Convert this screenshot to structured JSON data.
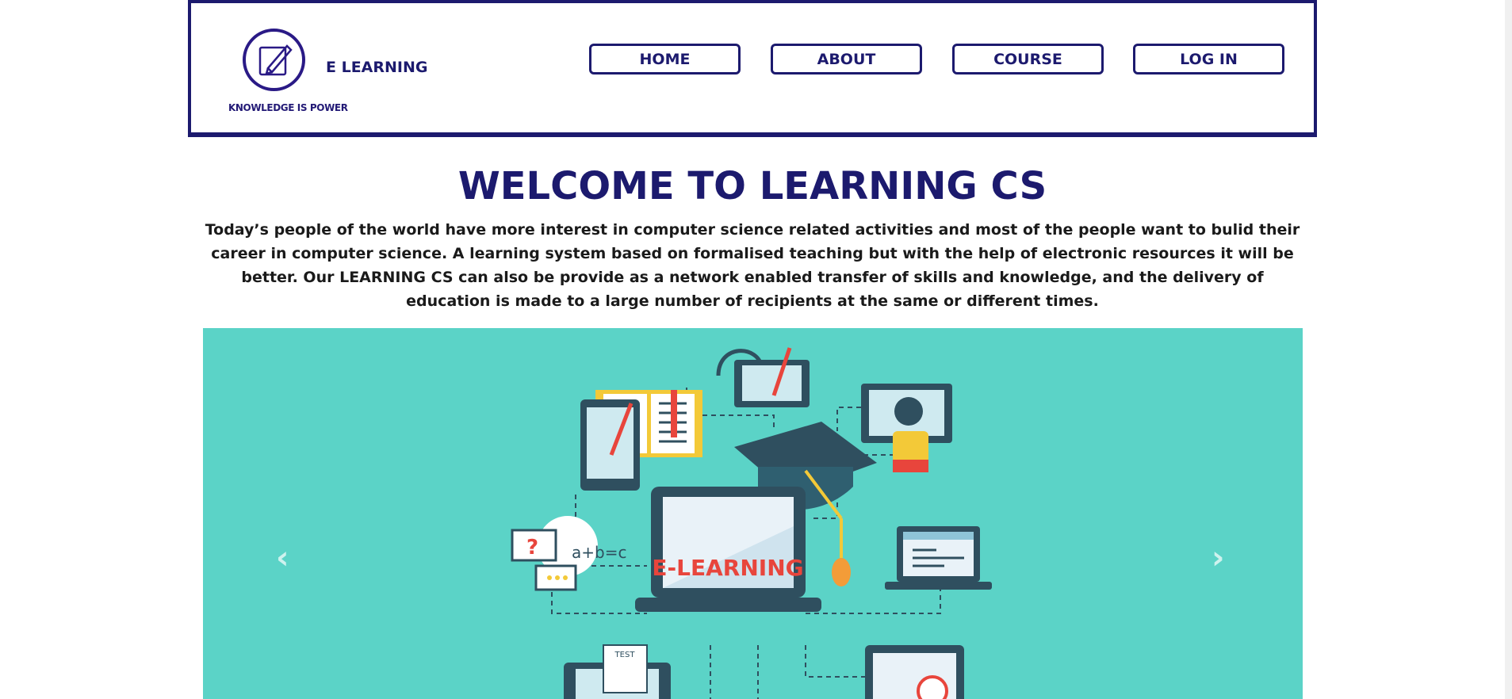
{
  "header": {
    "logo_tagline": "KNOWLEDGE IS POWER",
    "brand": "E LEARNING",
    "nav": [
      {
        "label": "HOME"
      },
      {
        "label": "ABOUT"
      },
      {
        "label": "COURSE"
      },
      {
        "label": "LOG IN"
      }
    ]
  },
  "main": {
    "title": "WELCOME TO LEARNING CS",
    "intro": "Today’s people of the world have more interest in computer science related activities and most of the people want to bulid their career in computer science. A learning system based on formalised teaching but with the help of electronic resources it will be better. Our LEARNING CS can also be provide as a network enabled transfer of skills and knowledge, and the delivery of education is made to a large number of recipients at the same or different times."
  },
  "carousel": {
    "slide_caption": "E-LEARNING",
    "prev_icon": "chevron-left-icon",
    "next_icon": "chevron-right-icon",
    "background_color": "#5bd3c7"
  },
  "colors": {
    "brand": "#1c1a6e",
    "accent_red": "#e8453c"
  }
}
